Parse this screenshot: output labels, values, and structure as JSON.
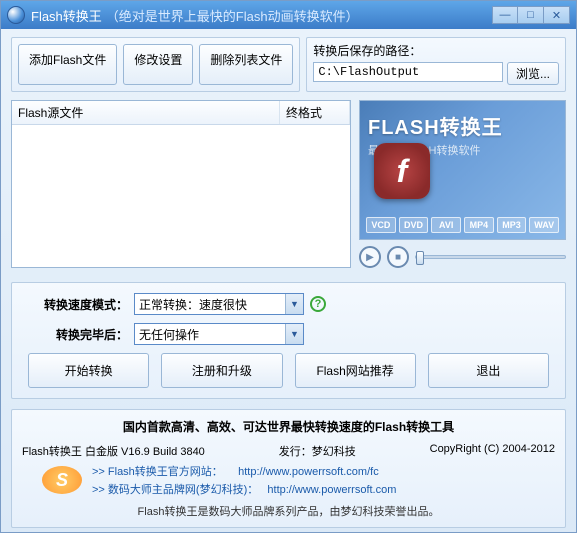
{
  "titlebar": {
    "app": "Flash转换王",
    "extra": "（绝对是世界上最快的Flash动画转换软件）"
  },
  "toolbar": {
    "add": "添加Flash文件",
    "modify": "修改设置",
    "delete": "删除列表文件"
  },
  "path": {
    "label": "转换后保存的路径：",
    "value": "C:\\FlashOutput",
    "browse": "浏览..."
  },
  "filelist": {
    "col1": "Flash源文件",
    "col2": "终格式"
  },
  "preview": {
    "title": "FLASH转换王",
    "subtitle": "最快的FLASH转换软件",
    "f": "f",
    "badges": [
      "VCD",
      "DVD",
      "AVI",
      "MP4",
      "MP3",
      "WAV"
    ]
  },
  "settings": {
    "speed_label": "转换速度模式：",
    "speed_value": "正常转换：速度很快",
    "after_label": "转换完毕后：",
    "after_value": "无任何操作"
  },
  "actions": {
    "start": "开始转换",
    "register": "注册和升级",
    "recommend": "Flash网站推荐",
    "exit": "退出"
  },
  "footer": {
    "slogan": "国内首款高清、高效、可达世界最快转换速度的Flash转换工具",
    "version": "Flash转换王 白金版 V16.9 Build 3840",
    "publisher": "发行：梦幻科技",
    "copyright": "CopyRight (C) 2004-2012",
    "link1_label": ">> Flash转换王官方网站：",
    "link1_url": "http://www.powerrsoft.com/fc",
    "link2_label": ">> 数码大师主品牌网(梦幻科技)：",
    "link2_url": "http://www.powerrsoft.com",
    "bottom": "Flash转换王是数码大师品牌系列产品，由梦幻科技荣誉出品。",
    "logo": "S"
  }
}
